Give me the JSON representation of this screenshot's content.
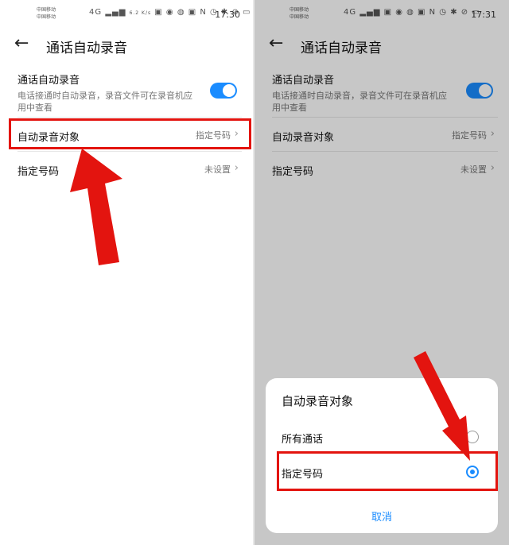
{
  "left": {
    "status": {
      "carrier1": "中国移动",
      "carrier2": "中国移动",
      "net": "4G",
      "speed": "6.2 K/s",
      "time": "17:30"
    },
    "header": {
      "title": "通话自动录音"
    },
    "auto_record": {
      "title": "通话自动录音",
      "desc": "电话接通时自动录音，录音文件可在录音机应用中查看",
      "enabled": true
    },
    "rows": [
      {
        "label": "自动录音对象",
        "value": "指定号码"
      },
      {
        "label": "指定号码",
        "value": "未设置"
      }
    ]
  },
  "right": {
    "status": {
      "carrier1": "中国移动",
      "carrier2": "中国移动",
      "net": "4G",
      "time": "17:31"
    },
    "header": {
      "title": "通话自动录音"
    },
    "auto_record": {
      "title": "通话自动录音",
      "desc": "电话接通时自动录音，录音文件可在录音机应用中查看",
      "enabled": true
    },
    "rows": [
      {
        "label": "自动录音对象",
        "value": "指定号码"
      },
      {
        "label": "指定号码",
        "value": "未设置"
      }
    ],
    "dialog": {
      "title": "自动录音对象",
      "options": [
        {
          "label": "所有通话",
          "selected": false
        },
        {
          "label": "指定号码",
          "selected": true
        }
      ],
      "cancel": "取消"
    }
  },
  "colors": {
    "accent": "#1a8cff",
    "annotation_red": "#e3140f"
  },
  "icons": [
    "back-arrow-icon",
    "chevron-right-icon",
    "toggle-switch",
    "radio-button"
  ]
}
